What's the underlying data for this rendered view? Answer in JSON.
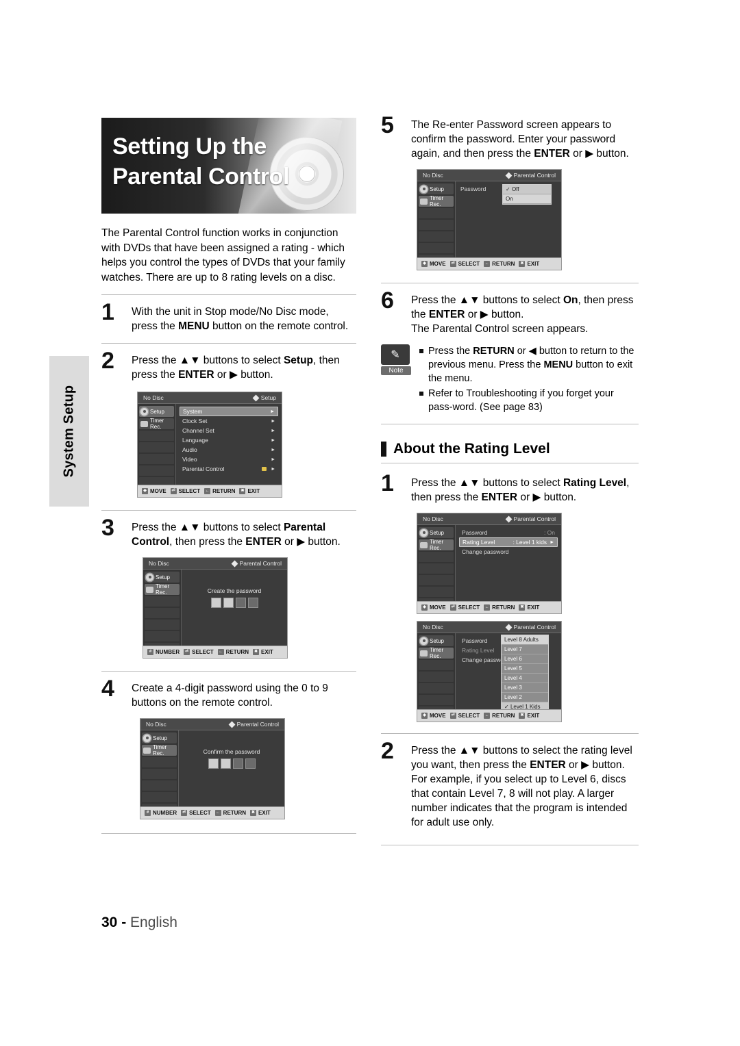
{
  "sidetab": {
    "label": "System Setup"
  },
  "title": {
    "text": "Setting Up the Parental Control"
  },
  "intro": {
    "text": "The Parental Control function works in conjunction with DVDs that have been assigned a rating - which helps you control the types of DVDs that your family watches. There are up to 8 rating levels on a disc."
  },
  "steps_left": [
    {
      "num": "1",
      "text_html": "With the unit in Stop mode/No Disc mode, press the <b>MENU</b> button on the remote control."
    },
    {
      "num": "2",
      "text_html": "Press the ▲▼ buttons to select <b>Setup</b>, then press the <b>ENTER</b> or ▶ button."
    },
    {
      "num": "3",
      "text_html": "Press the ▲▼ buttons to select <b>Parental Control</b>, then press the <b>ENTER</b> or ▶ button."
    },
    {
      "num": "4",
      "text_html": "Create a 4-digit password using the 0 to 9 buttons on the remote control."
    }
  ],
  "steps_right": [
    {
      "num": "5",
      "text_html": "The Re-enter Password screen appears to confirm the password. Enter your password again, and then press the <b>ENTER</b> or ▶ button."
    },
    {
      "num": "6",
      "text_html": "Press the ▲▼ buttons to select <b>On</b>, then press the <b>ENTER</b> or ▶ button.<br>The Parental Control screen appears."
    }
  ],
  "note": {
    "caption": "Note",
    "lines_html": [
      "Press the <b>RETURN</b> or ◀ button to return to the previous menu. Press the <b>MENU</b> button to exit the menu.",
      "Refer to Troubleshooting if you forget your pass-word. (See page 83)"
    ]
  },
  "section": {
    "heading": "About the Rating Level"
  },
  "steps_rating": [
    {
      "num": "1",
      "text_html": "Press the ▲▼ buttons to select <b>Rating Level</b>, then press the <b>ENTER</b> or ▶ button."
    },
    {
      "num": "2",
      "text_html": "Press the ▲▼ buttons to select the rating level you want, then press the <b>ENTER</b> or ▶ button.<br>For example, if you select up to Level 6, discs that contain Level 7, 8 will not play. A larger number indicates that the program is intended for adult use only."
    }
  ],
  "osd": {
    "common": {
      "no_disc": "No Disc",
      "nav_setup": "Setup",
      "nav_timer": "Timer Rec.",
      "bottom_move": "MOVE",
      "bottom_select": "SELECT",
      "bottom_return": "RETURN",
      "bottom_exit": "EXIT",
      "bottom_number": "NUMBER"
    },
    "setup_menu": {
      "header_right": "Setup",
      "items": [
        "System",
        "Clock Set",
        "Channel Set",
        "Language",
        "Audio",
        "Video",
        "Parental Control"
      ],
      "selected_index": 0,
      "lock_item_index": 6
    },
    "create_password": {
      "header_right": "Parental Control",
      "prompt": "Create the password",
      "cells": 4
    },
    "confirm_password": {
      "header_right": "Parental Control",
      "prompt": "Confirm the password",
      "cells": 4
    },
    "password_onoff": {
      "header_right": "Parental Control",
      "row_label": "Password",
      "options": [
        "Off",
        "On"
      ],
      "checked": "Off"
    },
    "rating_level_screen": {
      "header_right": "Parental Control",
      "rows": [
        {
          "label": "Password",
          "value": ": On"
        },
        {
          "label": "Rating Level",
          "value": ": Level 1 kids"
        },
        {
          "label": "Change password",
          "value": ""
        }
      ],
      "selected_row": 1
    },
    "rating_dropdown": {
      "header_right": "Parental Control",
      "rows": [
        {
          "label": "Password",
          "value": ""
        },
        {
          "label": "Rating Level",
          "value": ""
        },
        {
          "label": "Change password",
          "value": ""
        }
      ],
      "options": [
        "Level 8 Adults",
        "Level 7",
        "Level 6",
        "Level 5",
        "Level 4",
        "Level 3",
        "Level 2",
        "Level 1 Kids"
      ],
      "checked": "Level 1 Kids"
    }
  },
  "footer": {
    "page": "30 -",
    "language": "English"
  }
}
